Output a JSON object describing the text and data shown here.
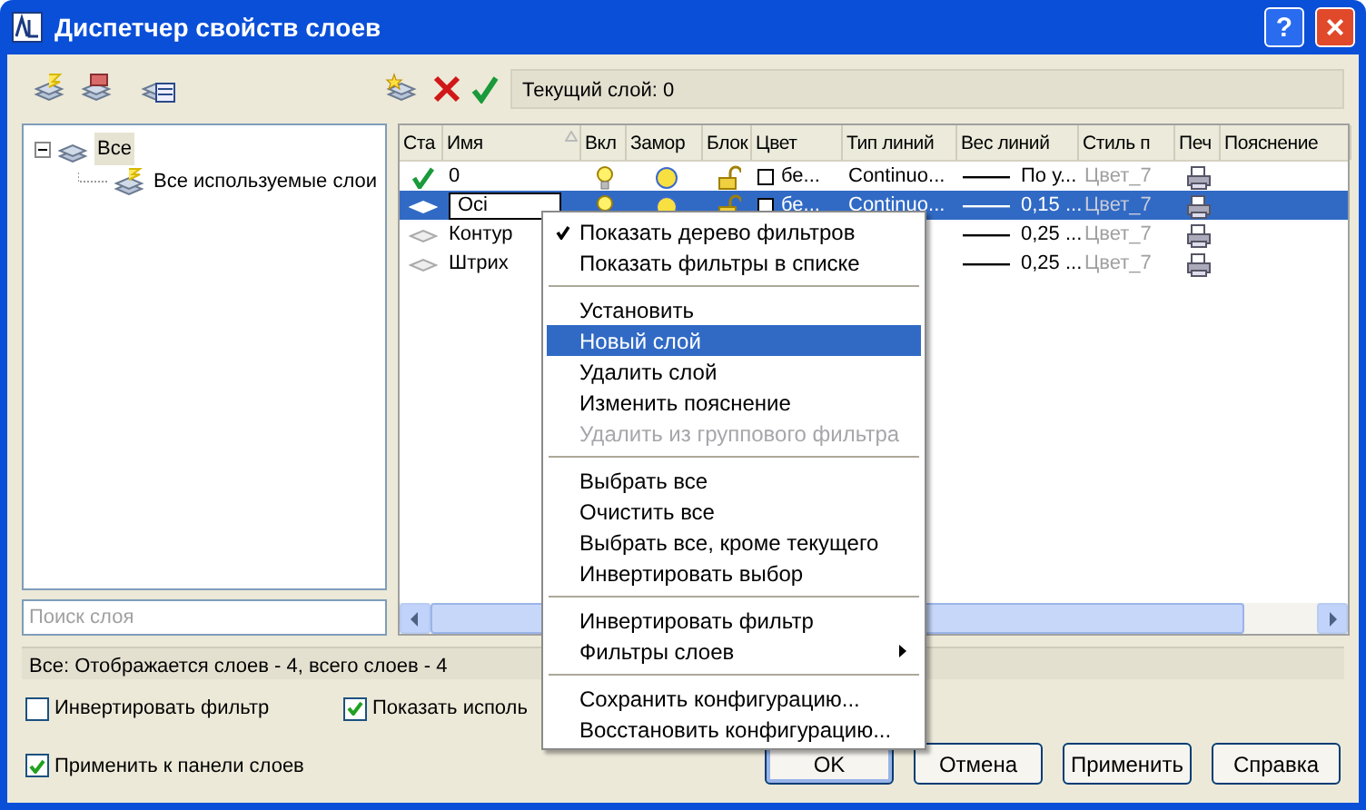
{
  "window": {
    "title": "Диспетчер свойств слоев",
    "help": "?",
    "close": "×"
  },
  "current_layer": "Текущий слой: 0",
  "tree": [
    {
      "label": "Все",
      "selected": true,
      "expanded": true,
      "children": [
        {
          "label": "Все используемые слои",
          "selected": false
        }
      ]
    }
  ],
  "search": {
    "placeholder": "Поиск слоя"
  },
  "table": {
    "columns": [
      {
        "label": "Ста"
      },
      {
        "label": "Имя",
        "sorted": true
      },
      {
        "label": "Вкл"
      },
      {
        "label": "Замор"
      },
      {
        "label": "Блок"
      },
      {
        "label": "Цвет"
      },
      {
        "label": "Тип линий"
      },
      {
        "label": "Вес линий"
      },
      {
        "label": "Стиль п"
      },
      {
        "label": "Печ"
      },
      {
        "label": "Пояснение"
      }
    ],
    "rows": [
      {
        "kind": "current",
        "name": "0",
        "selected": false,
        "editing": false,
        "on": true,
        "frozen": false,
        "locked": false,
        "color_name": "бе...",
        "linetype": "Continuo...",
        "lineweight": "По у...",
        "plot_style": "Цвет_7"
      },
      {
        "kind": "layer",
        "name": "Oci",
        "selected": true,
        "editing": true,
        "on": true,
        "frozen": false,
        "locked": false,
        "color_name": "бе...",
        "linetype": "Continuo...",
        "lineweight": "0,15 ...",
        "plot_style": "Цвет_7"
      },
      {
        "kind": "layer",
        "name": "Контур",
        "selected": false,
        "editing": false,
        "lineweight": "0,25 ...",
        "plot_style": "Цвет_7"
      },
      {
        "kind": "layer",
        "name": "Штрих",
        "selected": false,
        "editing": false,
        "lineweight": "0,25 ...",
        "plot_style": "Цвет_7"
      }
    ]
  },
  "status_bar": "Все: Отображается слоев - 4, всего слоев - 4",
  "options": [
    {
      "label": "Инвертировать фильтр",
      "checked": false
    },
    {
      "label": "Показать исполь",
      "checked": true
    },
    {
      "label": "Применить к панели слоев",
      "checked": true
    }
  ],
  "buttons": [
    {
      "label": "OK",
      "default": true
    },
    {
      "label": "Отмена",
      "default": false
    },
    {
      "label": "Применить",
      "default": false
    },
    {
      "label": "Справка",
      "default": false
    }
  ],
  "context_menu": {
    "items": [
      {
        "kind": "item",
        "label": "Показать дерево фильтров",
        "checked": true,
        "selected": false,
        "disabled": false
      },
      {
        "kind": "item",
        "label": "Показать фильтры в списке",
        "checked": false,
        "selected": false,
        "disabled": false
      },
      {
        "kind": "separator"
      },
      {
        "kind": "item",
        "label": "Установить",
        "checked": false,
        "selected": false,
        "disabled": false
      },
      {
        "kind": "item",
        "label": "Новый слой",
        "checked": false,
        "selected": true,
        "disabled": false
      },
      {
        "kind": "item",
        "label": "Удалить слой",
        "checked": false,
        "selected": false,
        "disabled": false
      },
      {
        "kind": "item",
        "label": "Изменить пояснение",
        "checked": false,
        "selected": false,
        "disabled": false
      },
      {
        "kind": "item",
        "label": "Удалить из группового фильтра",
        "checked": false,
        "selected": false,
        "disabled": true
      },
      {
        "kind": "separator"
      },
      {
        "kind": "item",
        "label": "Выбрать все",
        "checked": false,
        "selected": false,
        "disabled": false
      },
      {
        "kind": "item",
        "label": "Очистить все",
        "checked": false,
        "selected": false,
        "disabled": false
      },
      {
        "kind": "item",
        "label": "Выбрать все, кроме текущего",
        "checked": false,
        "selected": false,
        "disabled": false
      },
      {
        "kind": "item",
        "label": "Инвертировать выбор",
        "checked": false,
        "selected": false,
        "disabled": false
      },
      {
        "kind": "separator"
      },
      {
        "kind": "item",
        "label": "Инвертировать фильтр",
        "checked": false,
        "selected": false,
        "disabled": false
      },
      {
        "kind": "submenu",
        "label": "Фильтры слоев",
        "checked": false,
        "selected": false,
        "disabled": false
      },
      {
        "kind": "separator"
      },
      {
        "kind": "item",
        "label": "Сохранить конфигурацию...",
        "checked": false,
        "selected": false,
        "disabled": false
      },
      {
        "kind": "item",
        "label": "Восстановить конфигурацию...",
        "checked": false,
        "selected": false,
        "disabled": false
      }
    ]
  }
}
